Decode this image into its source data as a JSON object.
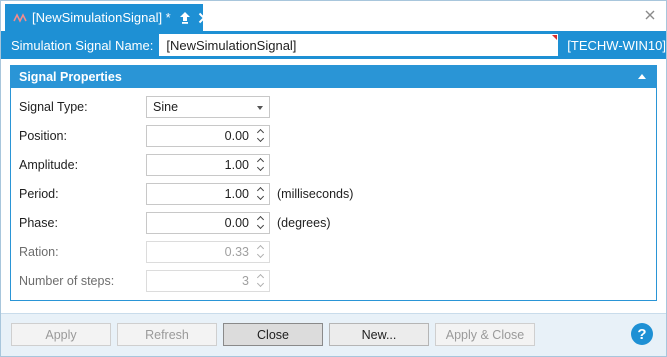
{
  "tab": {
    "title": "[NewSimulationSignal] *",
    "icon": "signal-icon"
  },
  "name_bar": {
    "label": "Simulation Signal Name:",
    "value": "[NewSimulationSignal]",
    "machine": "[TECHW-WIN10]"
  },
  "panel": {
    "title": "Signal Properties",
    "rows": {
      "signal_type": {
        "label": "Signal Type:",
        "value": "Sine"
      },
      "position": {
        "label": "Position:",
        "value": "0.00"
      },
      "amplitude": {
        "label": "Amplitude:",
        "value": "1.00"
      },
      "period": {
        "label": "Period:",
        "value": "1.00",
        "unit": "(milliseconds)"
      },
      "phase": {
        "label": "Phase:",
        "value": "0.00",
        "unit": "(degrees)"
      },
      "ration": {
        "label": "Ration:",
        "value": "0.33"
      },
      "steps": {
        "label": "Number of steps:",
        "value": "3"
      }
    }
  },
  "buttons": {
    "apply": "Apply",
    "refresh": "Refresh",
    "close": "Close",
    "new": "New...",
    "apply_close": "Apply & Close",
    "help": "?"
  },
  "colors": {
    "accent": "#1e90d4",
    "panel_border": "#2a95d6",
    "required_marker": "#d9302f"
  }
}
